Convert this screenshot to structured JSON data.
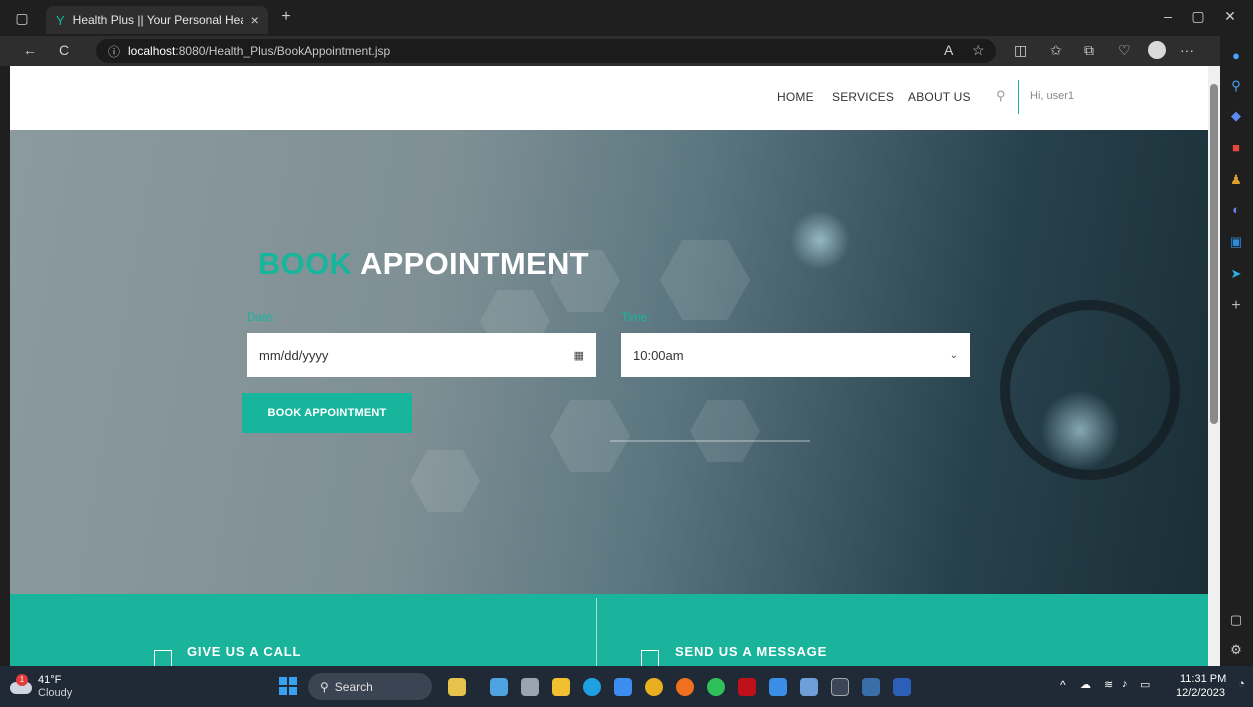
{
  "browser": {
    "tab_title": "Health Plus || Your Personal Heal",
    "tab_close": "×",
    "new_tab": "+",
    "url_host": "localhost",
    "url_path": ":8080/Health_Plus/BookAppointment.jsp",
    "back": "←",
    "refresh": "C",
    "info": "ⓘ",
    "more": "···"
  },
  "nav": {
    "items": [
      "HOME",
      "SERVICES",
      "ABOUT US"
    ],
    "greeting": "Hi, user1"
  },
  "hero": {
    "title_accent": "BOOK",
    "title_rest": "APPOINTMENT",
    "date_label": "Date:",
    "date_placeholder": "mm/dd/yyyy",
    "time_label": "Time:",
    "time_value": "10:00am",
    "button_label": "BOOK APPOINTMENT"
  },
  "contact": {
    "call_title": "GIVE US A CALL",
    "message_title": "SEND US A MESSAGE"
  },
  "taskbar": {
    "weather_temp": "41°F",
    "weather_desc": "Cloudy",
    "weather_badge": "1",
    "search_label": "Search",
    "time": "11:31 PM",
    "date": "12/2/2023"
  },
  "colors": {
    "accent": "#17b59b",
    "contact_band": "#1ab39c",
    "taskbar": "#202a36"
  }
}
